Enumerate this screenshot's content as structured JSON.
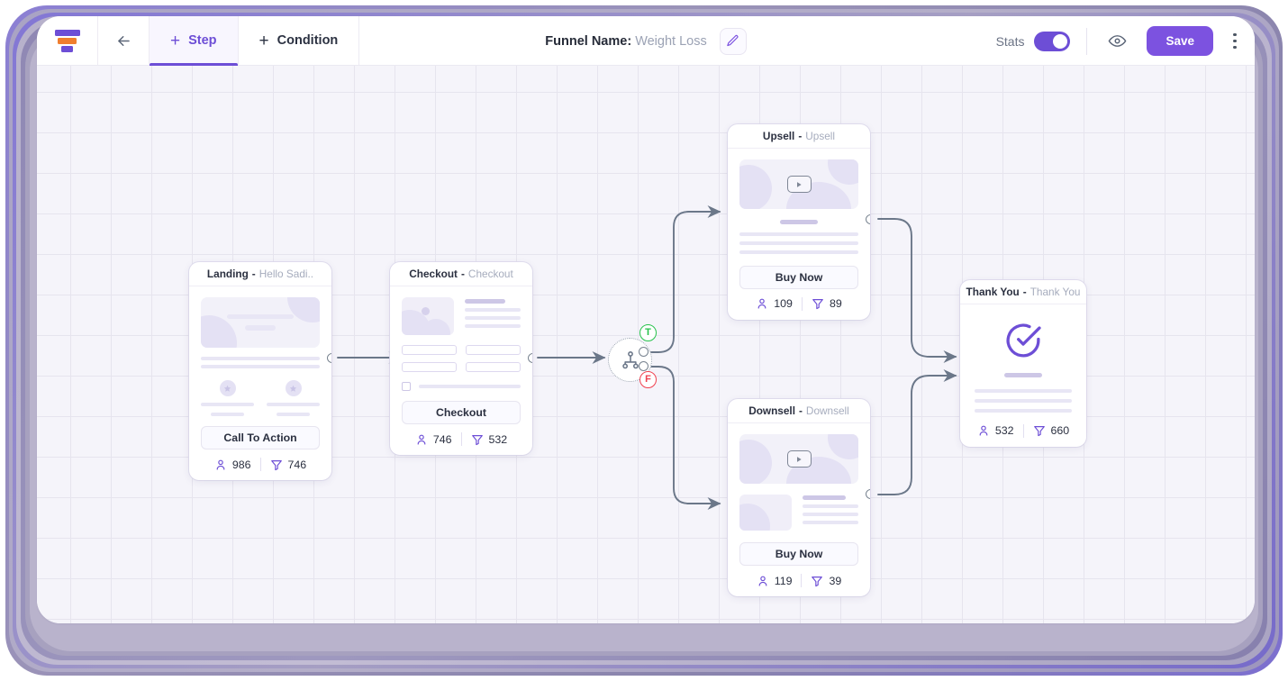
{
  "app": {
    "logo_icon": "funnel-logo-icon",
    "accent": "#6d4ed6",
    "save_accent": "#7c52e0",
    "canvas_bg": "#f5f4fa",
    "grid_line": "#e6e4ee"
  },
  "toolbar": {
    "back_icon": "arrow-left-icon",
    "tabs": [
      {
        "label": "Step",
        "icon": "plus-icon",
        "active": true
      },
      {
        "label": "Condition",
        "icon": "plus-icon",
        "active": false
      }
    ],
    "title_label": "Funnel Name:",
    "title_value": "Weight Loss",
    "edit_icon": "pencil-icon",
    "stats_label": "Stats",
    "stats_toggle_on": true,
    "preview_icon": "eye-icon",
    "save_label": "Save",
    "more_icon": "kebab-menu-icon"
  },
  "nodes": {
    "landing": {
      "title": "Landing",
      "subtitle": "Hello Sadi..",
      "cta_label": "Call To Action",
      "visitors": "986",
      "conversions": "746"
    },
    "checkout": {
      "title": "Checkout",
      "subtitle": "Checkout",
      "cta_label": "Checkout",
      "visitors": "746",
      "conversions": "532"
    },
    "upsell": {
      "title": "Upsell",
      "subtitle": "Upsell",
      "cta_label": "Buy Now",
      "visitors": "109",
      "conversions": "89"
    },
    "downsell": {
      "title": "Downsell",
      "subtitle": "Downsell",
      "cta_label": "Buy Now",
      "visitors": "119",
      "conversions": "39"
    },
    "thankyou": {
      "title": "Thank You",
      "subtitle": "Thank You",
      "visitors": "532",
      "conversions": "660"
    }
  },
  "condition": {
    "icon": "hierarchy-icon",
    "true_badge": "T",
    "false_badge": "F",
    "true_color": "#27c24c",
    "false_color": "#f0414f"
  },
  "icons": {
    "visitor": "person-icon",
    "conversion": "funnel-icon",
    "play": "play-icon",
    "check": "check-circle-icon"
  },
  "separator": "-"
}
